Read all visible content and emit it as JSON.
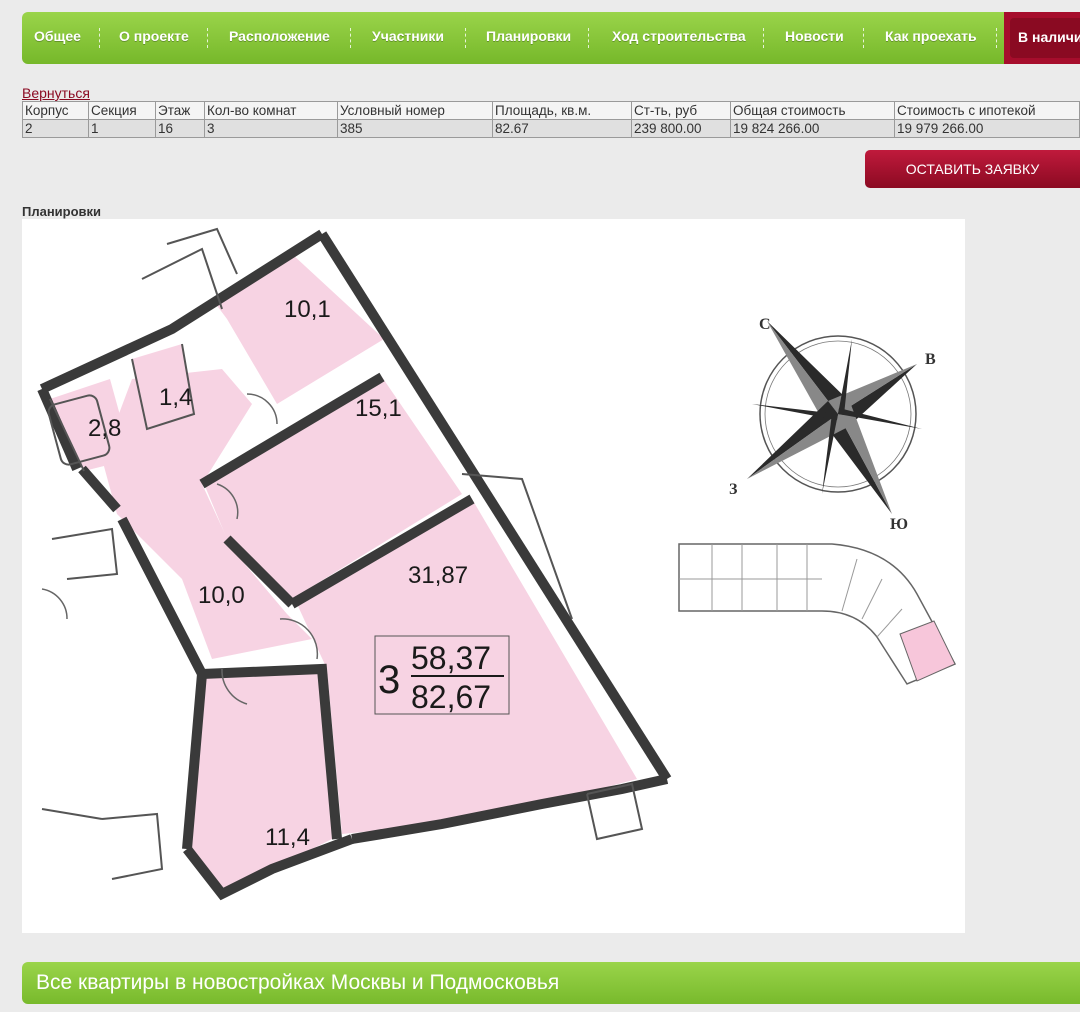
{
  "nav": {
    "items": [
      "Общее",
      "О проекте",
      "Расположение",
      "Участники",
      "Планировки",
      "Ход строительства",
      "Новости",
      "Как проехать"
    ],
    "active": "В наличии"
  },
  "back_link": "Вернуться",
  "table": {
    "headers": [
      "Корпус",
      "Секция",
      "Этаж",
      "Кол-во комнат",
      "Условный номер",
      "Площадь, кв.м.",
      "Ст-ть, руб",
      "Общая стоимость",
      "Стоимость с ипотекой"
    ],
    "values": [
      "2",
      "1",
      "16",
      "3",
      "385",
      "82.67",
      "239 800.00",
      "19 824 266.00",
      "19 979 266.00"
    ]
  },
  "order_button": "ОСТАВИТЬ ЗАЯВКУ",
  "plans_title": "Планировки",
  "plan": {
    "rooms": [
      "10,1",
      "15,1",
      "1,4",
      "2,8",
      "10,0",
      "31,87",
      "11,4"
    ],
    "summary_rooms": "3",
    "living_area": "58,37",
    "total_area": "82,67",
    "compass": [
      "С",
      "В",
      "Ю",
      "З"
    ]
  },
  "colors": {
    "nav_green": "#86c43a",
    "accent_red": "#a60d2c",
    "room_pink": "#f7d3e3",
    "wall": "#3a3a3a"
  },
  "footer_title": "Все квартиры в новостройках Москвы и Подмосковья"
}
